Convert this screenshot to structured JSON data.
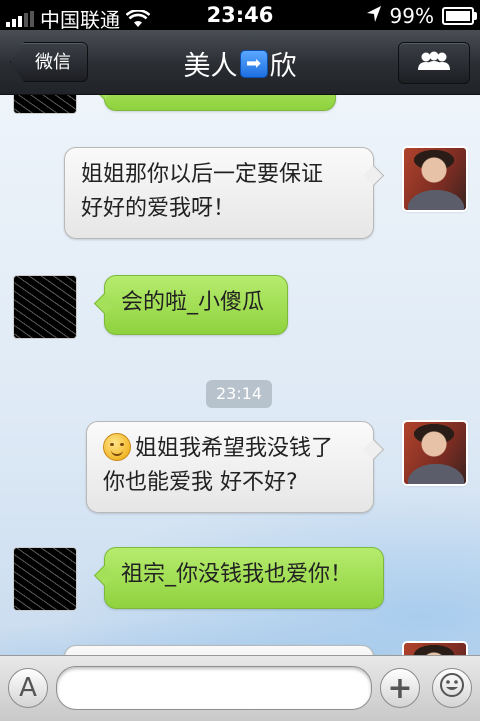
{
  "status_bar": {
    "carrier": "中国联通",
    "time": "23:46",
    "battery_label": "99%",
    "battery_level": 0.99,
    "signal_bars": 3,
    "icons": [
      "signal-icon",
      "wifi-icon",
      "location-arrow-icon",
      "battery-icon"
    ]
  },
  "nav": {
    "back_label": "微信",
    "title_left": "美人",
    "title_emoji": "➡",
    "title_right": "欣",
    "right_icon": "group-icon"
  },
  "messages": [
    {
      "side": "left",
      "avatar": "avatar-black",
      "text": ""
    },
    {
      "side": "right",
      "avatar": "avatar-photo",
      "line1": "姐姐那你以后一定要保证",
      "line2": "好好的爱我呀！"
    },
    {
      "side": "left",
      "avatar": "avatar-black",
      "text": "会的啦_小傻瓜"
    },
    {
      "timestamp": "23:14"
    },
    {
      "side": "right",
      "avatar": "avatar-photo",
      "emoji": "smile-emoji-icon",
      "line1": "姐姐我希望我没钱了",
      "line2": "你也能爱我 好不好?"
    },
    {
      "side": "left",
      "avatar": "avatar-black",
      "text": "祖宗_你没钱我也爱你！"
    }
  ],
  "input_bar": {
    "left_icon": "a-keyboard-icon",
    "left_label": "A",
    "placeholder": "",
    "add_label": "+",
    "add_icon": "plus-icon",
    "emoji_icon": "smiley-icon"
  }
}
